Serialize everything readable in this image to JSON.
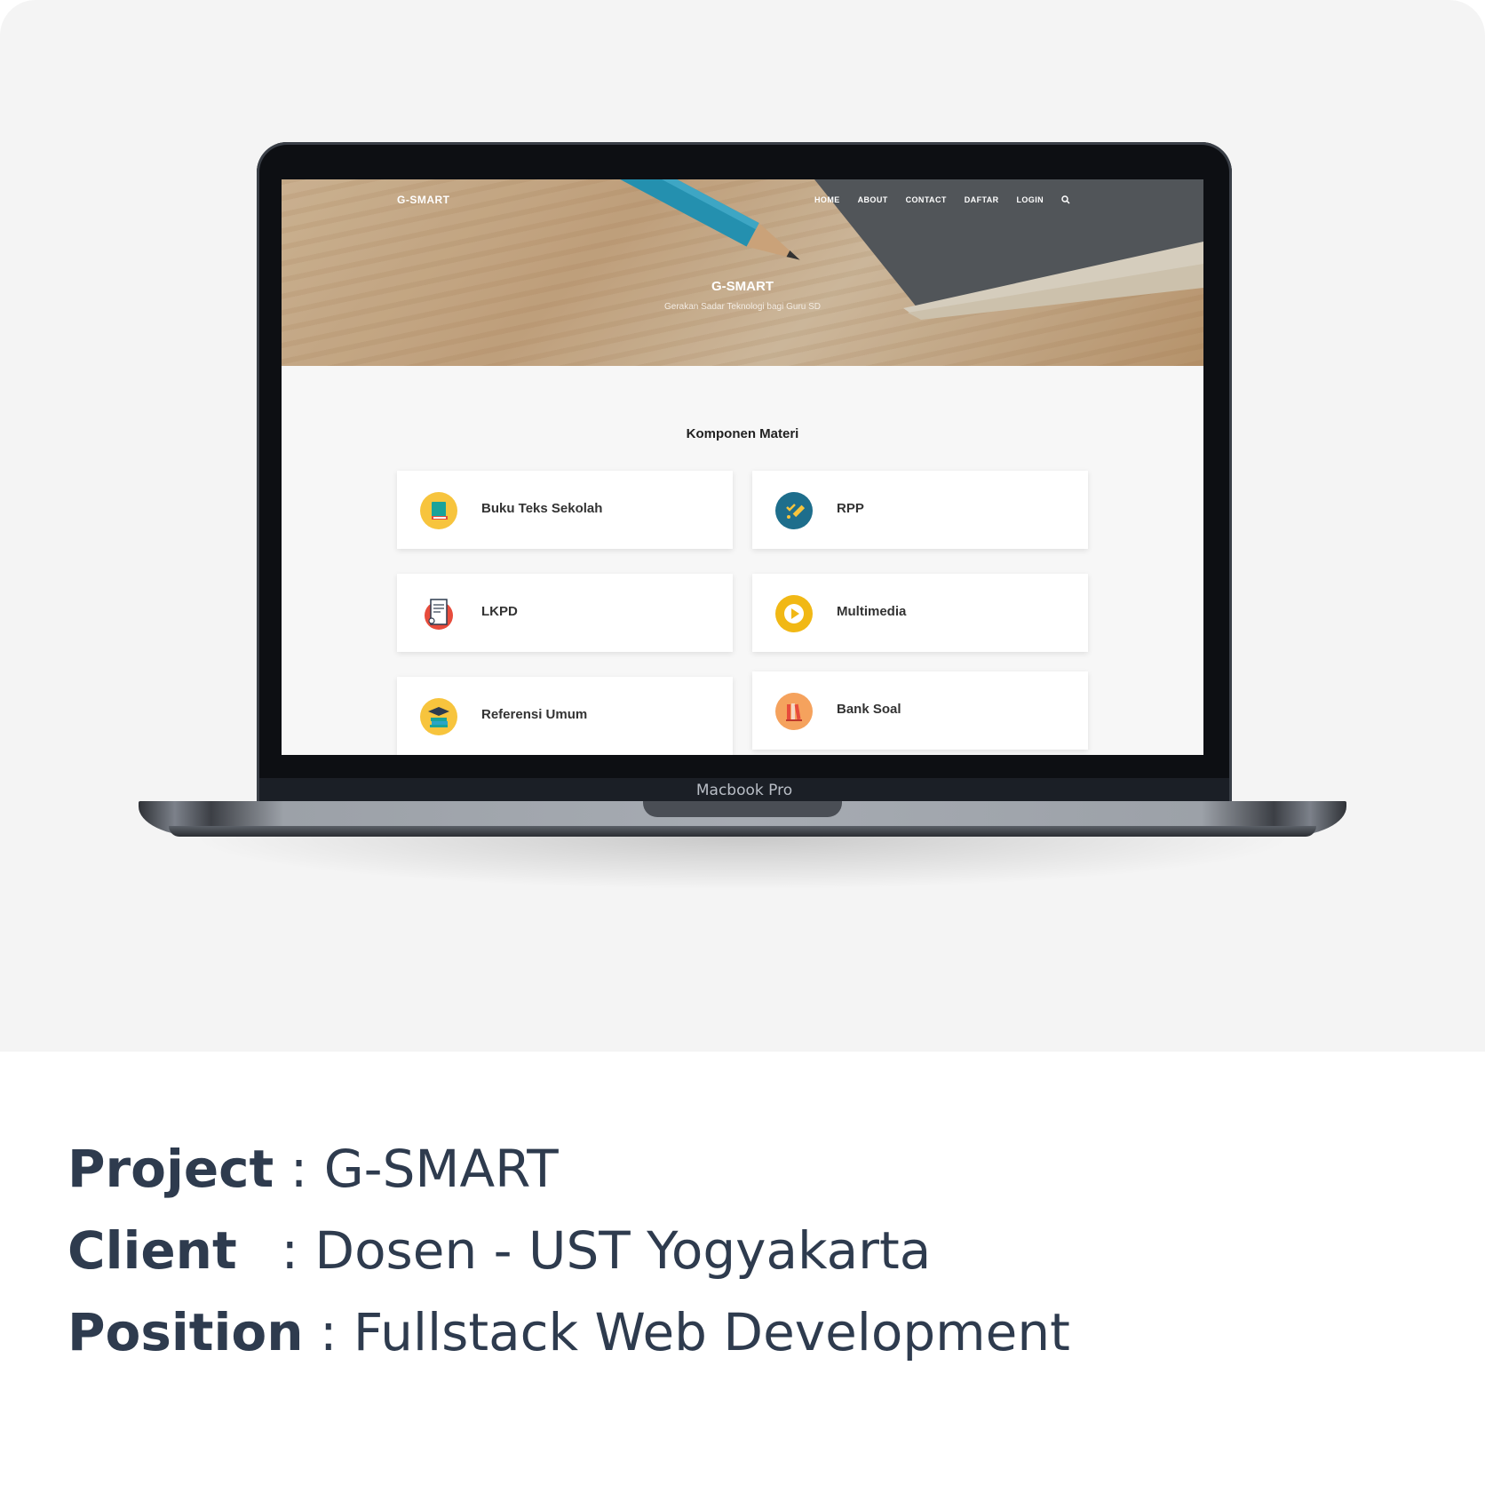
{
  "website": {
    "logo": "G-SMART",
    "nav": [
      "HOME",
      "ABOUT",
      "CONTACT",
      "DAFTAR",
      "LOGIN"
    ],
    "hero_title": "G-SMART",
    "hero_subtitle": "Gerakan Sadar Teknologi bagi Guru SD",
    "section_title": "Komponen Materi",
    "cards": [
      {
        "label": "Buku Teks Sekolah",
        "icon": "book-icon",
        "color": "#f7c43d"
      },
      {
        "label": "RPP",
        "icon": "pen-checklist-icon",
        "color": "#1e6e8c"
      },
      {
        "label": "LKPD",
        "icon": "certificate-icon",
        "color": "#e74c3c"
      },
      {
        "label": "Multimedia",
        "icon": "play-icon",
        "color": "#f1b815"
      },
      {
        "label": "Referensi Umum",
        "icon": "graduation-books-icon",
        "color": "#f7c43d"
      },
      {
        "label": "Bank Soal",
        "icon": "books-icon",
        "color": "#f5a25d"
      }
    ]
  },
  "device_label": "Macbook Pro",
  "info": {
    "project_label": "Project",
    "project_value": ": G-SMART",
    "client_label": "Client",
    "client_value": ": Dosen - UST Yogyakarta",
    "position_label": "Position",
    "position_value": ": Fullstack Web Development"
  }
}
